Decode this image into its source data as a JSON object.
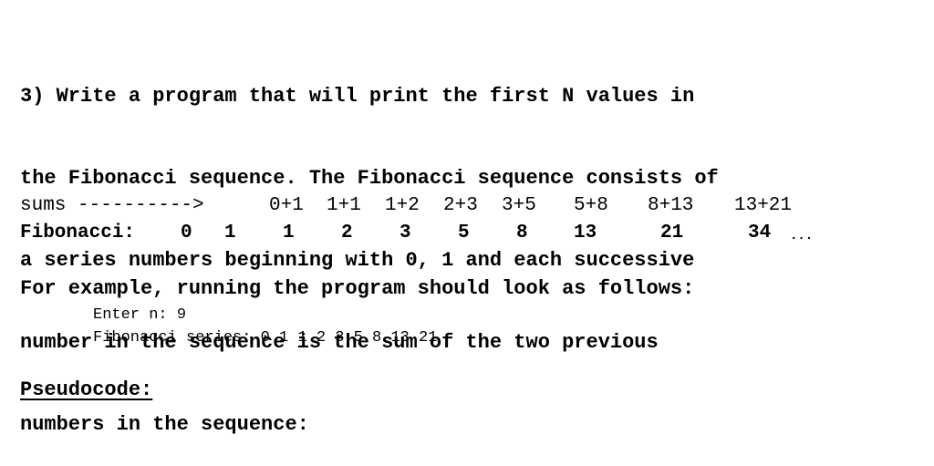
{
  "question": {
    "lines": [
      "3) Write a program that will print the first N values in",
      "the Fibonacci sequence. The Fibonacci sequence consists of",
      "a series numbers beginning with 0, 1 and each successive",
      "number in the sequence is the sum of the two previous",
      "numbers in the sequence:"
    ]
  },
  "sums_row": {
    "label": "sums ---------->",
    "items": [
      "0+1",
      "1+1",
      "1+2",
      "2+3",
      "3+5",
      "5+8",
      "8+13",
      "13+21"
    ]
  },
  "fibonacci_row": {
    "label": "Fibonacci:",
    "values": [
      "0",
      "1",
      "1",
      "2",
      "3",
      "5",
      "8",
      "13",
      "21",
      "34"
    ],
    "ellipsis": "..."
  },
  "example": {
    "heading": "For example, running the program should look as follows:",
    "prompt_line": "Enter n: 9",
    "output_line": "Fibonacci series: 0 1 1 2 3 5 8 13 21"
  },
  "pseudocode_heading": "Pseudocode:"
}
